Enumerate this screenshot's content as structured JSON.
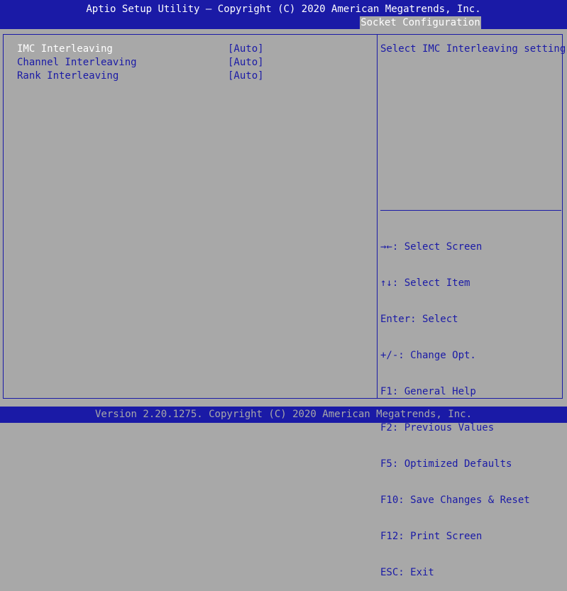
{
  "header": {
    "title": "Aptio Setup Utility – Copyright (C) 2020 American Megatrends, Inc.",
    "active_tab": "Socket Configuration"
  },
  "settings": [
    {
      "label": "IMC Interleaving",
      "value": "[Auto]"
    },
    {
      "label": "Channel Interleaving",
      "value": "[Auto]"
    },
    {
      "label": "Rank Interleaving",
      "value": "[Auto]"
    }
  ],
  "help": {
    "text": "Select IMC Interleaving setting"
  },
  "keys": [
    "→←: Select Screen",
    "↑↓: Select Item",
    "Enter: Select",
    "+/-: Change Opt.",
    "F1: General Help",
    "F2: Previous Values",
    "F5: Optimized Defaults",
    "F10: Save Changes & Reset",
    "F12: Print Screen",
    "ESC: Exit"
  ],
  "footer": {
    "version": "Version 2.20.1275. Copyright (C) 2020 American Megatrends, Inc."
  },
  "colors": {
    "background": "#a8a8a8",
    "bar": "#1a1aa6",
    "highlight": "#ffffff"
  }
}
